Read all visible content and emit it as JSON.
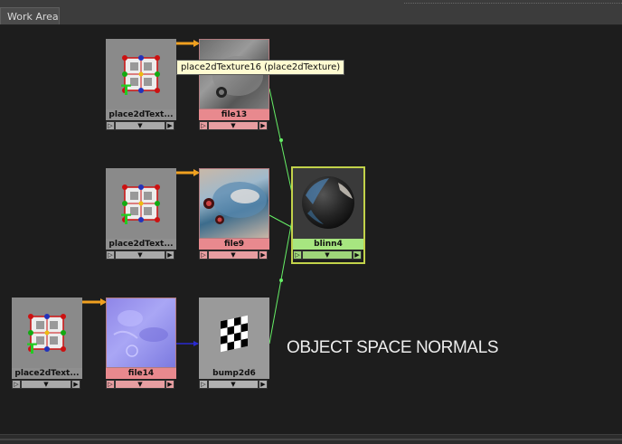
{
  "tab": {
    "label": "Work Area"
  },
  "tooltip": {
    "text": "place2dTexture16 (place2dTexture)"
  },
  "annotation": {
    "text": "OBJECT SPACE NORMALS"
  },
  "nodes": {
    "p1": {
      "label": "place2dText..."
    },
    "p2": {
      "label": "place2dText..."
    },
    "p3": {
      "label": "place2dText..."
    },
    "file13": {
      "label": "file13"
    },
    "file9": {
      "label": "file9"
    },
    "file14": {
      "label": "file14"
    },
    "blinn4": {
      "label": "blinn4"
    },
    "bump": {
      "label": "bump2d6"
    }
  },
  "ports": {
    "left": "▷",
    "mid": "▼",
    "right": "▶"
  },
  "colors": {
    "texture_node": "#e8898e",
    "shader_node": "#a7e680",
    "utility_node": "#8f8f8f",
    "color_connection": "#f0a020",
    "bump_connection": "#2a2ad0",
    "output_connection": "#66ee66"
  }
}
